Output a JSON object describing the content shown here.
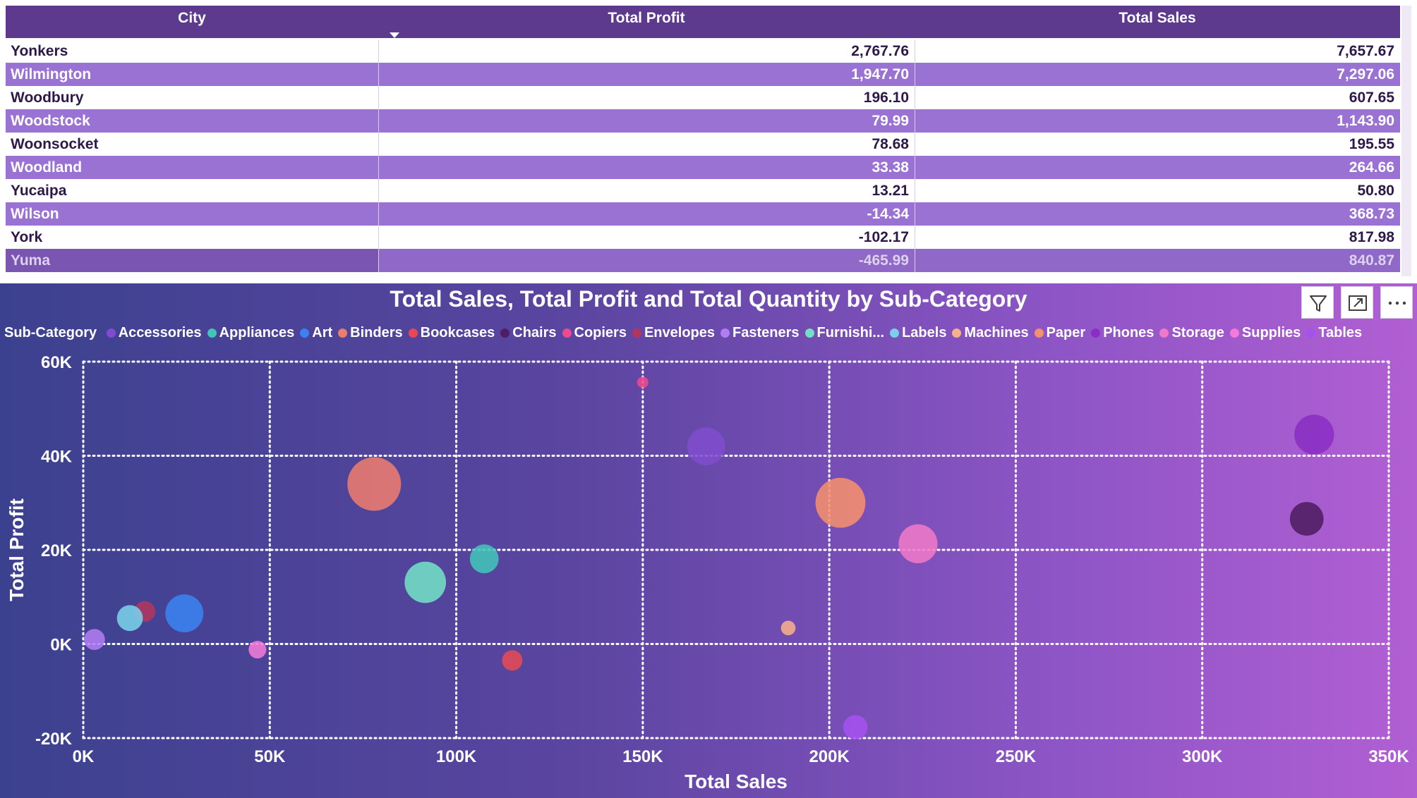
{
  "table": {
    "columns": [
      "City",
      "Total Profit",
      "Total Sales"
    ],
    "sort_icon": "sort-descending-icon",
    "rows": [
      {
        "city": "Yonkers",
        "profit": "2,767.76",
        "sales": "7,657.67"
      },
      {
        "city": "Wilmington",
        "profit": "1,947.70",
        "sales": "7,297.06"
      },
      {
        "city": "Woodbury",
        "profit": "196.10",
        "sales": "607.65"
      },
      {
        "city": "Woodstock",
        "profit": "79.99",
        "sales": "1,143.90"
      },
      {
        "city": "Woonsocket",
        "profit": "78.68",
        "sales": "195.55"
      },
      {
        "city": "Woodland",
        "profit": "33.38",
        "sales": "264.66"
      },
      {
        "city": "Yucaipa",
        "profit": "13.21",
        "sales": "50.80"
      },
      {
        "city": "Wilson",
        "profit": "-14.34",
        "sales": "368.73"
      },
      {
        "city": "York",
        "profit": "-102.17",
        "sales": "817.98"
      },
      {
        "city": "Yuma",
        "profit": "-465.99",
        "sales": "840.87"
      }
    ]
  },
  "visual_header": {
    "icons": [
      "filter-icon",
      "focus-mode-icon",
      "more-options-icon"
    ]
  },
  "chart_data": {
    "type": "scatter",
    "title": "Total Sales, Total Profit and Total Quantity by Sub-Category",
    "xlabel": "Total Sales",
    "ylabel": "Total Profit",
    "xlim": [
      0,
      350000
    ],
    "ylim": [
      -20000,
      60000
    ],
    "x_ticks": [
      0,
      50000,
      100000,
      150000,
      200000,
      250000,
      300000,
      350000
    ],
    "x_tick_labels": [
      "0K",
      "50K",
      "100K",
      "150K",
      "200K",
      "250K",
      "300K",
      "350K"
    ],
    "y_ticks": [
      -20000,
      0,
      20000,
      40000,
      60000
    ],
    "y_tick_labels": [
      "-20K",
      "0K",
      "20K",
      "40K",
      "60K"
    ],
    "grid": true,
    "legend_title": "Sub-Category",
    "legend_position": "top-left",
    "size_measure": "Total Quantity",
    "series": [
      {
        "name": "Accessories",
        "color": "#7f4ccd",
        "x": 167000,
        "y": 42000,
        "size": 2976
      },
      {
        "name": "Appliances",
        "color": "#43c4b8",
        "x": 107500,
        "y": 18100,
        "size": 1729
      },
      {
        "name": "Art",
        "color": "#3b82f0",
        "x": 27100,
        "y": 6500,
        "size": 3000
      },
      {
        "name": "Binders",
        "color": "#ec7c6e",
        "x": 78000,
        "y": 34000,
        "size": 5974
      },
      {
        "name": "Bookcases",
        "color": "#e54a54",
        "x": 115000,
        "y": -3500,
        "size": 868
      },
      {
        "name": "Chairs",
        "color": "#4e1e62",
        "x": 328000,
        "y": 26600,
        "size": 2356
      },
      {
        "name": "Copiers",
        "color": "#ea4a8f",
        "x": 150000,
        "y": 55600,
        "size": 234
      },
      {
        "name": "Envelopes",
        "color": "#b0355f",
        "x": 16500,
        "y": 6900,
        "size": 906
      },
      {
        "name": "Fasteners",
        "color": "#b27cf2",
        "x": 3000,
        "y": 950,
        "size": 914
      },
      {
        "name": "Furnishings",
        "color": "#72dfc6",
        "x": 91700,
        "y": 13100,
        "size": 3563
      },
      {
        "name": "Labels",
        "color": "#7ad0ea",
        "x": 12500,
        "y": 5500,
        "size": 1400
      },
      {
        "name": "Machines",
        "color": "#f6b08a",
        "x": 189000,
        "y": 3400,
        "size": 440
      },
      {
        "name": "Paper",
        "color": "#f5906e",
        "x": 203000,
        "y": 30000,
        "size": 5178
      },
      {
        "name": "Phones",
        "color": "#8b2fc4",
        "x": 330000,
        "y": 44500,
        "size": 3289
      },
      {
        "name": "Storage",
        "color": "#ef79c8",
        "x": 223800,
        "y": 21300,
        "size": 3158
      },
      {
        "name": "Supplies",
        "color": "#f27ad8",
        "x": 46700,
        "y": -1200,
        "size": 647
      },
      {
        "name": "Tables",
        "color": "#a452ef",
        "x": 207000,
        "y": -17700,
        "size": 1241
      }
    ],
    "legend_labels": [
      "Accessories",
      "Appliances",
      "Art",
      "Binders",
      "Bookcases",
      "Chairs",
      "Copiers",
      "Envelopes",
      "Fasteners",
      "Furnishi...",
      "Labels",
      "Machines",
      "Paper",
      "Phones",
      "Storage",
      "Supplies",
      "Tables"
    ]
  }
}
